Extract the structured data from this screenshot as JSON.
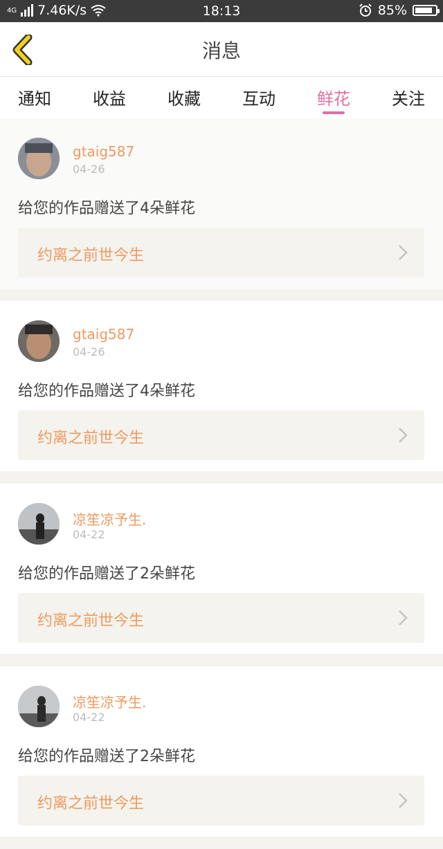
{
  "status": {
    "network": "4G",
    "speed": "7.46K/s",
    "time": "18:13",
    "battery": "85%",
    "battery_level": 0.85
  },
  "header": {
    "title": "消息",
    "back_icon": "chevron-left-icon"
  },
  "tabs": [
    {
      "label": "通知",
      "active": false
    },
    {
      "label": "收益",
      "active": false
    },
    {
      "label": "收藏",
      "active": false
    },
    {
      "label": "互动",
      "active": false
    },
    {
      "label": "鲜花",
      "active": true
    },
    {
      "label": "关注",
      "active": false
    }
  ],
  "items": [
    {
      "user": "gtaig587",
      "date": "04-26",
      "message": "给您的作品赠送了4朵鲜花",
      "work": "约离之前世今生"
    },
    {
      "user": "gtaig587",
      "date": "04-26",
      "message": "给您的作品赠送了4朵鲜花",
      "work": "约离之前世今生"
    },
    {
      "user": "凉笙凉予生.",
      "date": "04-22",
      "message": "给您的作品赠送了2朵鲜花",
      "work": "约离之前世今生"
    },
    {
      "user": "凉笙凉予生.",
      "date": "04-22",
      "message": "给您的作品赠送了2朵鲜花",
      "work": "约离之前世今生"
    }
  ],
  "colors": {
    "accent_pink": "#e36fa2",
    "accent_orange": "#ee9a5f",
    "back_yellow": "#e6c200"
  }
}
